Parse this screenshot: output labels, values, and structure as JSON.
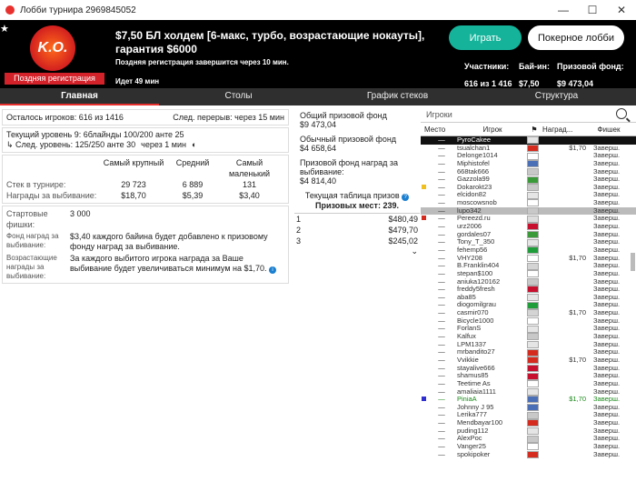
{
  "window": {
    "title": "Лобби турнира 2969845052",
    "min": "—",
    "max": "☐",
    "close": "✕"
  },
  "header": {
    "logo_text": "K.O.",
    "late_reg_badge": "Поздняя регистрация",
    "title": "$7,50 БЛ холдем [6-макс, турбо, возрастающие нокауты], гарантия $6000",
    "subtitle": "Поздняя регистрация завершится через 10 мин.",
    "running": "Идет 49 мин",
    "play_button": "Играть",
    "lobby_button": "Покерное лобби",
    "participants_label": "Участники:",
    "participants_value": "616 из 1 416",
    "buyin_label": "Бай-ин:",
    "buyin_value": "$7,50",
    "prizepool_label": "Призовой фонд:",
    "prizepool_value": "$9 473,04"
  },
  "tabs": [
    "Главная",
    "Столы",
    "График стеков",
    "Структура"
  ],
  "left": {
    "remaining": "Осталось игроков: 616 из 1416",
    "next_break": "След. перерыв: через 15 мин",
    "current_level": "Текущий уровень 9: 6блайнды 100/200 анте 25",
    "next_level": "↳ След. уровень: 125/250 анте 30",
    "next_level_time": "через 1 мин",
    "stack_headers": [
      "Самый крупный",
      "Средний",
      "Самый маленький"
    ],
    "stack_label": "Стек в турнире:",
    "stack_values": [
      "29 723",
      "6 889",
      "131"
    ],
    "bounty_label": "Награды за выбивание:",
    "bounty_values": [
      "$18,70",
      "$5,39",
      "$3,40"
    ],
    "start_chips_label": "Стартовые фишки:",
    "start_chips_value": "3 000",
    "bounty_fund_label": "Фонд наград за выбивание:",
    "bounty_fund_value": "$3,40 каждого байина будет добавлено к призовому фонду наград за выбивание.",
    "progressive_label": "Возрастающие награды за выбивание:",
    "progressive_value": "За каждого выбитого игрока награда за Ваше выбивание будет увеличиваться минимум на $1,70."
  },
  "mid": {
    "total_prize_label": "Общий призовой фонд",
    "total_prize_value": "$9 473,04",
    "regular_prize_label": "Обычный призовой фонд",
    "regular_prize_value": "$4 658,64",
    "bounty_prize_label": "Призовой фонд наград за выбивание:",
    "bounty_prize_value": "$4 814,40",
    "payouts_title": "Текущая таблица призов",
    "paid_places": "Призовых мест: 239.",
    "payouts": [
      {
        "place": "1",
        "prize": "$480,49"
      },
      {
        "place": "2",
        "prize": "$479,70"
      },
      {
        "place": "3",
        "prize": "$245,02"
      }
    ],
    "chevron": "⌄"
  },
  "right": {
    "search_placeholder": "Игроки",
    "columns": [
      "Место",
      "Игрок",
      "⚑",
      "Наград...",
      "Фишек"
    ],
    "players": [
      {
        "place": "—",
        "name": "PyroCakee",
        "prize": "",
        "chips": "",
        "style": "hl1",
        "flag": "#e4e4e4"
      },
      {
        "place": "—",
        "name": "tsualchan1",
        "prize": "$1,70",
        "chips": "Заверш.",
        "flag": "#d52b1e"
      },
      {
        "place": "—",
        "name": "Delonge1014",
        "prize": "",
        "chips": "Заверш.",
        "flag": "#ffffff"
      },
      {
        "place": "—",
        "name": "Miphistofel",
        "prize": "",
        "chips": "Заверш.",
        "flag": "#4b6fb7"
      },
      {
        "place": "—",
        "name": "668tak666",
        "prize": "",
        "chips": "Заверш.",
        "flag": "#c8c8c8"
      },
      {
        "place": "—",
        "name": "Gazzola99",
        "prize": "",
        "chips": "Заверш.",
        "flag": "#3a9a3a"
      },
      {
        "place": "—",
        "name": "Dokarokt23",
        "prize": "",
        "chips": "Заверш.",
        "flag": "#c8c8c8",
        "mark": "#f0c020"
      },
      {
        "place": "—",
        "name": "elcidon82",
        "prize": "",
        "chips": "Заверш.",
        "flag": "#e5e5e5"
      },
      {
        "place": "—",
        "name": "moscowsnob",
        "prize": "",
        "chips": "Заверш.",
        "flag": "#ffffff"
      },
      {
        "place": "—",
        "name": "lupo342",
        "prize": "",
        "chips": "Заверш.",
        "style": "hl2",
        "flag": "#c8c8c8"
      },
      {
        "place": "—",
        "name": "Pereezd.ru",
        "prize": "",
        "chips": "Заверш.",
        "flag": "#dddddd",
        "mark": "#d52b1e"
      },
      {
        "place": "—",
        "name": "urz2006",
        "prize": "",
        "chips": "Заверш.",
        "flag": "#c8102e"
      },
      {
        "place": "—",
        "name": "gordales07",
        "prize": "",
        "chips": "Заверш.",
        "flag": "#3a9a3a"
      },
      {
        "place": "—",
        "name": "Tony_T_350",
        "prize": "",
        "chips": "Заверш.",
        "flag": "#e5e5e5"
      },
      {
        "place": "—",
        "name": "fehemp56",
        "prize": "",
        "chips": "Заверш.",
        "flag": "#1f9d3a"
      },
      {
        "place": "—",
        "name": "VHY208",
        "prize": "$1,70",
        "chips": "Заверш.",
        "flag": "#ffffff"
      },
      {
        "place": "—",
        "name": "B.Franklin404",
        "prize": "",
        "chips": "Заверш.",
        "flag": "#d4d4d4"
      },
      {
        "place": "—",
        "name": "stepan$100",
        "prize": "",
        "chips": "Заверш.",
        "flag": "#ffffff"
      },
      {
        "place": "—",
        "name": "aniuka120162",
        "prize": "",
        "chips": "Заверш.",
        "flag": "#c8c8c8"
      },
      {
        "place": "—",
        "name": "freddy5fresh",
        "prize": "",
        "chips": "Заверш.",
        "flag": "#c8102e"
      },
      {
        "place": "—",
        "name": "aba85",
        "prize": "",
        "chips": "Заверш.",
        "flag": "#e5e5e5"
      },
      {
        "place": "—",
        "name": "diogomilgrau",
        "prize": "",
        "chips": "Заверш.",
        "flag": "#1f9d3a"
      },
      {
        "place": "—",
        "name": "casmir070",
        "prize": "$1,70",
        "chips": "Заверш.",
        "flag": "#d4d4d4"
      },
      {
        "place": "—",
        "name": "Bicycle1000",
        "prize": "",
        "chips": "Заверш.",
        "flag": "#ffffff"
      },
      {
        "place": "—",
        "name": "ForlanS",
        "prize": "",
        "chips": "Заверш.",
        "flag": "#e5e5e5"
      },
      {
        "place": "—",
        "name": "Kalfux",
        "prize": "",
        "chips": "Заверш.",
        "flag": "#c8c8c8"
      },
      {
        "place": "—",
        "name": "LPM1337",
        "prize": "",
        "chips": "Заверш.",
        "flag": "#e5e5e5"
      },
      {
        "place": "—",
        "name": "mrbandito27",
        "prize": "",
        "chips": "Заверш.",
        "flag": "#d52b1e"
      },
      {
        "place": "—",
        "name": "Vvikkie",
        "prize": "$1,70",
        "chips": "Заверш.",
        "flag": "#d52b1e"
      },
      {
        "place": "—",
        "name": "stayalive666",
        "prize": "",
        "chips": "Заверш.",
        "flag": "#c8102e"
      },
      {
        "place": "—",
        "name": "shamus85",
        "prize": "",
        "chips": "Заверш.",
        "flag": "#c8102e"
      },
      {
        "place": "—",
        "name": "Teetime As",
        "prize": "",
        "chips": "Заверш.",
        "flag": "#ffffff"
      },
      {
        "place": "—",
        "name": "amaliaia1111",
        "prize": "",
        "chips": "Заверш.",
        "flag": "#e5e5e5"
      },
      {
        "place": "—",
        "name": "PiniaA",
        "prize": "$1,70",
        "chips": "Заверш.",
        "style": "hl3",
        "flag": "#4b6fb7",
        "mark": "#3030d0"
      },
      {
        "place": "—",
        "name": "Johnny J 95",
        "prize": "",
        "chips": "Заверш.",
        "flag": "#4b6fb7"
      },
      {
        "place": "—",
        "name": "Lerika777",
        "prize": "",
        "chips": "Заверш.",
        "flag": "#c8c8c8"
      },
      {
        "place": "—",
        "name": "Mendbayar100",
        "prize": "",
        "chips": "Заверш.",
        "flag": "#d52b1e"
      },
      {
        "place": "—",
        "name": "puding112",
        "prize": "",
        "chips": "Заверш.",
        "flag": "#e5e5e5"
      },
      {
        "place": "—",
        "name": "AlexPoc",
        "prize": "",
        "chips": "Заверш.",
        "flag": "#c8c8c8"
      },
      {
        "place": "—",
        "name": "Vanger25",
        "prize": "",
        "chips": "Заверш.",
        "flag": "#ffffff"
      },
      {
        "place": "—",
        "name": "spokipoker",
        "prize": "",
        "chips": "Заверш.",
        "flag": "#d52b1e"
      }
    ]
  }
}
